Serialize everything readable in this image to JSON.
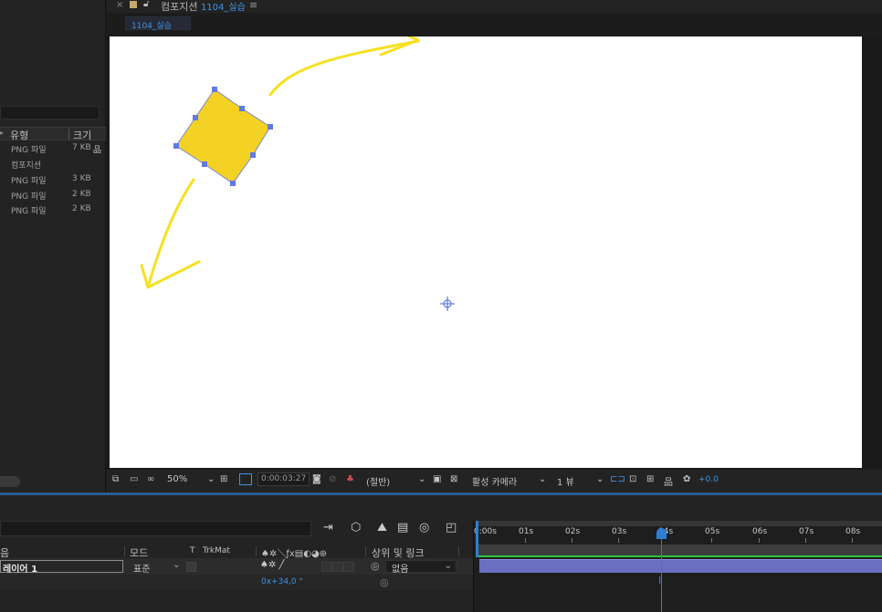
{
  "project": {
    "header_type": "유형",
    "header_size": "크기",
    "rows": [
      {
        "type": "PNG 파일",
        "size": "7 KB",
        "flow_icon": "flowchart-icon"
      },
      {
        "type": "컴포지션",
        "size": ""
      },
      {
        "type": "PNG 파일",
        "size": "3 KB"
      },
      {
        "type": "PNG 파일",
        "size": "2 KB"
      },
      {
        "type": "PNG 파일",
        "size": "2 KB"
      }
    ]
  },
  "comp": {
    "tab_prefix": "컴포지션",
    "tab_name": "1104_실습",
    "subtab": "1104_실습",
    "shape_color": "#f4d224",
    "arrow_color": "#f7e021",
    "handle_color": "#5f7ae3"
  },
  "viewer_toolbar": {
    "zoom": "50%",
    "timecode": "0:00:03:27",
    "resolution": "(절반)",
    "camera": "활성 카메라",
    "views": "1 뷰",
    "exposure": "+0.0"
  },
  "timeline": {
    "columns": {
      "name": "음",
      "mode": "모드",
      "t": "T",
      "trkmat": "TrkMat",
      "parent_link": "상위 및 링크"
    },
    "layer": {
      "name": "레이어 1",
      "mode": "표준",
      "parent": "없음"
    },
    "property_value": "0x+34,0 °",
    "ruler": [
      "0:00s",
      "01s",
      "02s",
      "03s",
      "04s",
      "05s",
      "06s",
      "07s",
      "08s"
    ]
  }
}
